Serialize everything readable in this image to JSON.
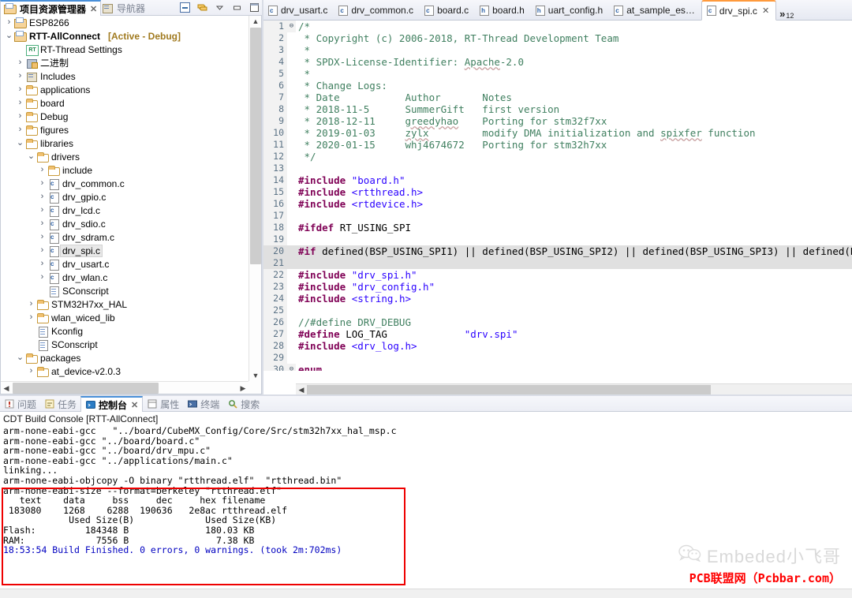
{
  "explorer": {
    "tabs": [
      {
        "label": "项目资源管理器",
        "icon": "project-explorer-icon",
        "active": true,
        "close": "✕"
      },
      {
        "label": "导航器",
        "icon": "navigator-icon",
        "active": false
      }
    ],
    "toolbar": [
      {
        "name": "collapse-all-icon",
        "title": "折叠全部"
      },
      {
        "name": "link-with-editor-icon",
        "title": "链接编辑器"
      },
      {
        "name": "view-menu-icon",
        "title": "视图菜单"
      },
      {
        "name": "minimize-icon",
        "title": "最小化"
      },
      {
        "name": "maximize-icon",
        "title": "最大化"
      }
    ],
    "tree": [
      {
        "indent": 0,
        "arrow": "collapsed",
        "icon": "project-icon",
        "label": "ESP8266",
        "bold": false,
        "badge": "",
        "selected": false
      },
      {
        "indent": 0,
        "arrow": "expanded",
        "icon": "project-icon",
        "label": "RTT-AllConnect",
        "bold": true,
        "badge": "[Active - Debug]",
        "selected": false
      },
      {
        "indent": 1,
        "arrow": "none",
        "icon": "rt-thread-icon",
        "label": "RT-Thread Settings",
        "bold": false,
        "badge": "",
        "selected": false
      },
      {
        "indent": 1,
        "arrow": "collapsed",
        "icon": "binaries-icon",
        "label": "二进制",
        "bold": false,
        "badge": "",
        "selected": false
      },
      {
        "indent": 1,
        "arrow": "collapsed",
        "icon": "includes-icon",
        "label": "Includes",
        "bold": false,
        "badge": "",
        "selected": false
      },
      {
        "indent": 1,
        "arrow": "collapsed",
        "icon": "folder-icon",
        "label": "applications",
        "bold": false,
        "badge": "",
        "selected": false
      },
      {
        "indent": 1,
        "arrow": "collapsed",
        "icon": "folder-icon",
        "label": "board",
        "bold": false,
        "badge": "",
        "selected": false
      },
      {
        "indent": 1,
        "arrow": "collapsed",
        "icon": "folder-icon",
        "label": "Debug",
        "bold": false,
        "badge": "",
        "selected": false
      },
      {
        "indent": 1,
        "arrow": "collapsed",
        "icon": "folder-icon",
        "label": "figures",
        "bold": false,
        "badge": "",
        "selected": false
      },
      {
        "indent": 1,
        "arrow": "expanded",
        "icon": "folder-icon",
        "label": "libraries",
        "bold": false,
        "badge": "",
        "selected": false
      },
      {
        "indent": 2,
        "arrow": "expanded",
        "icon": "folder-icon",
        "label": "drivers",
        "bold": false,
        "badge": "",
        "selected": false
      },
      {
        "indent": 3,
        "arrow": "collapsed",
        "icon": "folder-icon",
        "label": "include",
        "bold": false,
        "badge": "",
        "selected": false
      },
      {
        "indent": 3,
        "arrow": "collapsed",
        "icon": "c-file-icon",
        "label": "drv_common.c",
        "bold": false,
        "badge": "",
        "selected": false
      },
      {
        "indent": 3,
        "arrow": "collapsed",
        "icon": "c-file-icon",
        "label": "drv_gpio.c",
        "bold": false,
        "badge": "",
        "selected": false
      },
      {
        "indent": 3,
        "arrow": "collapsed",
        "icon": "c-file-icon",
        "label": "drv_lcd.c",
        "bold": false,
        "badge": "",
        "selected": false
      },
      {
        "indent": 3,
        "arrow": "collapsed",
        "icon": "c-file-icon",
        "label": "drv_sdio.c",
        "bold": false,
        "badge": "",
        "selected": false
      },
      {
        "indent": 3,
        "arrow": "collapsed",
        "icon": "c-file-icon",
        "label": "drv_sdram.c",
        "bold": false,
        "badge": "",
        "selected": false
      },
      {
        "indent": 3,
        "arrow": "collapsed",
        "icon": "c-file-icon",
        "label": "drv_spi.c",
        "bold": false,
        "badge": "",
        "selected": true
      },
      {
        "indent": 3,
        "arrow": "collapsed",
        "icon": "c-file-icon",
        "label": "drv_usart.c",
        "bold": false,
        "badge": "",
        "selected": false
      },
      {
        "indent": 3,
        "arrow": "collapsed",
        "icon": "c-file-icon",
        "label": "drv_wlan.c",
        "bold": false,
        "badge": "",
        "selected": false
      },
      {
        "indent": 3,
        "arrow": "none",
        "icon": "file-icon",
        "label": "SConscript",
        "bold": false,
        "badge": "",
        "selected": false
      },
      {
        "indent": 2,
        "arrow": "collapsed",
        "icon": "folder-icon",
        "label": "STM32H7xx_HAL",
        "bold": false,
        "badge": "",
        "selected": false
      },
      {
        "indent": 2,
        "arrow": "collapsed",
        "icon": "folder-icon",
        "label": "wlan_wiced_lib",
        "bold": false,
        "badge": "",
        "selected": false
      },
      {
        "indent": 2,
        "arrow": "none",
        "icon": "file-icon",
        "label": "Kconfig",
        "bold": false,
        "badge": "",
        "selected": false
      },
      {
        "indent": 2,
        "arrow": "none",
        "icon": "file-icon",
        "label": "SConscript",
        "bold": false,
        "badge": "",
        "selected": false
      },
      {
        "indent": 1,
        "arrow": "expanded",
        "icon": "folder-icon",
        "label": "packages",
        "bold": false,
        "badge": "",
        "selected": false
      },
      {
        "indent": 2,
        "arrow": "collapsed",
        "icon": "folder-icon",
        "label": "at_device-v2.0.3",
        "bold": false,
        "badge": "",
        "selected": false
      }
    ]
  },
  "editor": {
    "tabs": [
      {
        "label": "drv_usart.c",
        "kind": "c",
        "active": false
      },
      {
        "label": "drv_common.c",
        "kind": "c",
        "active": false
      },
      {
        "label": "board.c",
        "kind": "c",
        "active": false
      },
      {
        "label": "board.h",
        "kind": "h",
        "active": false
      },
      {
        "label": "uart_config.h",
        "kind": "h",
        "active": false
      },
      {
        "label": "at_sample_es…",
        "kind": "c",
        "active": false
      },
      {
        "label": "drv_spi.c",
        "kind": "c",
        "active": true,
        "close": "✕"
      }
    ],
    "overflow_chevron": "»",
    "overflow_count": "12",
    "lines": [
      {
        "n": "1",
        "fold": "⊖",
        "html": "<span class='cm'>/*</span>"
      },
      {
        "n": "2",
        "fold": "",
        "html": "<span class='cm'> * Copyright (c) 2006-2018, RT-Thread Development Team</span>"
      },
      {
        "n": "3",
        "fold": "",
        "html": "<span class='cm'> *</span>"
      },
      {
        "n": "4",
        "fold": "",
        "html": "<span class='cm'> * SPDX-License-Identifier: <span class='sq'>Apache</span>-2.0</span>"
      },
      {
        "n": "5",
        "fold": "",
        "html": "<span class='cm'> *</span>"
      },
      {
        "n": "6",
        "fold": "",
        "html": "<span class='cm'> * Change Logs:</span>"
      },
      {
        "n": "7",
        "fold": "",
        "html": "<span class='cm'> * Date           Author       Notes</span>"
      },
      {
        "n": "8",
        "fold": "",
        "html": "<span class='cm'> * 2018-11-5      SummerGift   first version</span>"
      },
      {
        "n": "9",
        "fold": "",
        "html": "<span class='cm'> * 2018-12-11     <span class='sq'>greedyhao</span>    Porting for stm32f7xx</span>"
      },
      {
        "n": "10",
        "fold": "",
        "html": "<span class='cm'> * 2019-01-03     <span class='sq'>zylx</span>         modify DMA initialization and <span class='sq'>spixfer</span> function</span>"
      },
      {
        "n": "11",
        "fold": "",
        "html": "<span class='cm'> * 2020-01-15     whj4674672   Porting for stm32h7xx</span>"
      },
      {
        "n": "12",
        "fold": "",
        "html": "<span class='cm'> */</span>"
      },
      {
        "n": "13",
        "fold": "",
        "html": ""
      },
      {
        "n": "14",
        "fold": "",
        "html": "<span class='pp'>#include</span> <span class='str'>\"board.h\"</span>"
      },
      {
        "n": "15",
        "fold": "",
        "html": "<span class='pp'>#include</span> <span class='str'>&lt;rtthread.h&gt;</span>"
      },
      {
        "n": "16",
        "fold": "",
        "html": "<span class='pp'>#include</span> <span class='str'>&lt;rtdevice.h&gt;</span>"
      },
      {
        "n": "17",
        "fold": "",
        "html": ""
      },
      {
        "n": "18",
        "fold": "",
        "html": "<span class='pp'>#ifdef</span> <span class='pl'>RT_USING_SPI</span>"
      },
      {
        "n": "19",
        "fold": "",
        "html": ""
      },
      {
        "n": "20",
        "fold": "",
        "hl": true,
        "html": "<span class='pp'>#if</span> <span class='pl'>defined(BSP_USING_SPI1) || defined(BSP_USING_SPI2) || defined(BSP_USING_SPI3) || defined(BSP_USING_S</span>"
      },
      {
        "n": "21",
        "fold": "",
        "hl": true,
        "html": ""
      },
      {
        "n": "22",
        "fold": "",
        "html": "<span class='pp'>#include</span> <span class='str'>\"drv_spi.h\"</span>"
      },
      {
        "n": "23",
        "fold": "",
        "html": "<span class='pp'>#include</span> <span class='str'>\"drv_config.h\"</span>"
      },
      {
        "n": "24",
        "fold": "",
        "html": "<span class='pp'>#include</span> <span class='str'>&lt;string.h&gt;</span>"
      },
      {
        "n": "25",
        "fold": "",
        "html": ""
      },
      {
        "n": "26",
        "fold": "",
        "html": "<span class='cm'>//#define DRV_DEBUG</span>"
      },
      {
        "n": "27",
        "fold": "",
        "html": "<span class='pp'>#define</span> <span class='pl'>LOG_TAG             </span><span class='str'>\"drv.spi\"</span>"
      },
      {
        "n": "28",
        "fold": "",
        "html": "<span class='pp'>#include</span> <span class='str'>&lt;drv_log.h&gt;</span>"
      },
      {
        "n": "29",
        "fold": "",
        "html": ""
      },
      {
        "n": "30",
        "fold": "⊖",
        "clip": true,
        "html": "<span class='pp'>enum</span>"
      }
    ]
  },
  "console": {
    "tabs": [
      {
        "label": "问题",
        "icon": "problems-icon",
        "active": false
      },
      {
        "label": "任务",
        "icon": "tasks-icon",
        "active": false
      },
      {
        "label": "控制台",
        "icon": "console-icon",
        "active": true,
        "close": "✕"
      },
      {
        "label": "属性",
        "icon": "properties-icon",
        "active": false
      },
      {
        "label": "终端",
        "icon": "terminal-icon",
        "active": false
      },
      {
        "label": "搜索",
        "icon": "search-icon",
        "active": false
      }
    ],
    "title": "CDT Build Console [RTT-AllConnect]",
    "output": [
      {
        "text": "arm-none-eabi-gcc   \"../board/CubeMX_Config/Core/Src/stm32h7xx_hal_msp.c",
        "color": "black"
      },
      {
        "text": "arm-none-eabi-gcc \"../board/board.c\"",
        "color": "black"
      },
      {
        "text": "arm-none-eabi-gcc \"../board/drv_mpu.c\"",
        "color": "black"
      },
      {
        "text": "arm-none-eabi-gcc \"../applications/main.c\"",
        "color": "black"
      },
      {
        "text": "linking...",
        "color": "black"
      },
      {
        "text": "arm-none-eabi-objcopy -O binary \"rtthread.elf\"  \"rtthread.bin\"",
        "color": "black"
      },
      {
        "text": "arm-none-eabi-size --format=berkeley \"rtthread.elf\"",
        "color": "black"
      },
      {
        "text": "   text    data     bss     dec     hex filename",
        "color": "black"
      },
      {
        "text": " 183080    1268    6288  190636   2e8ac rtthread.elf",
        "color": "black"
      },
      {
        "text": "",
        "color": "black"
      },
      {
        "text": "            Used Size(B)             Used Size(KB)",
        "color": "black"
      },
      {
        "text": "Flash:         184348 B              180.03 KB",
        "color": "black"
      },
      {
        "text": "RAM:             7556 B                7.38 KB",
        "color": "black"
      },
      {
        "text": "",
        "color": "black"
      },
      {
        "text": "18:53:54 Build Finished. 0 errors, 0 warnings. (took 2m:702ms)",
        "color": "blue"
      }
    ],
    "highlight_box_color": "#ee0000"
  },
  "build_summary": {
    "size_table_headers": [
      "text",
      "data",
      "bss",
      "dec",
      "hex",
      "filename"
    ],
    "size_table_values": [
      "183080",
      "1268",
      "6288",
      "190636",
      "2e8ac",
      "rtthread.elf"
    ],
    "memory": [
      {
        "name": "Flash:",
        "bytes": "184348 B",
        "kb": "180.03 KB"
      },
      {
        "name": "RAM:",
        "bytes": "7556 B",
        "kb": "7.38 KB"
      }
    ],
    "finished_time": "18:53:54",
    "errors": "0",
    "warnings": "0",
    "duration": "2m:702ms"
  },
  "watermark": {
    "wechat_icon": "wechat-icon",
    "line1": "Embeded小飞哥",
    "line2": "PCB联盟网（Pcbbar.com）",
    "line1_color": "#d9d9d9",
    "line2_color": "#ff0000"
  }
}
